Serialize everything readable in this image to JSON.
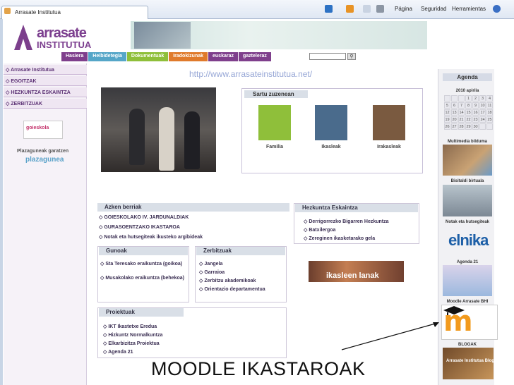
{
  "browser": {
    "tab_title": "Arrasate Institutua",
    "toolbar": {
      "page": "Página",
      "security": "Seguridad",
      "tools": "Herramientas"
    }
  },
  "header": {
    "logo_line1": "arrasate",
    "logo_line2": "INSTITUTUA"
  },
  "nav": {
    "items": [
      {
        "label": "Hasiera",
        "color": "#7f3f8c"
      },
      {
        "label": "Heibidetegia",
        "color": "#55a6c8"
      },
      {
        "label": "Dokumentuak",
        "color": "#8fbf3a"
      },
      {
        "label": "Iradokizunak",
        "color": "#e07a2b"
      },
      {
        "label": "euskaraz",
        "color": "#7f3f8c"
      },
      {
        "label": "gazteleraz",
        "color": "#7f3f8c"
      }
    ]
  },
  "url_watermark": "http://www.arrasateinstitutua.net/",
  "left_menu": {
    "items": [
      "Arrasate Institutua",
      "EGOITZAK",
      "HEZKUNTZA ESKAINTZA",
      "ZERBITZUAK"
    ],
    "goieskola": "goieskola",
    "plaza_label": "Plazaguneak garatzen",
    "plaza_logo": "plazagunea"
  },
  "sartu": {
    "title": "Sartu zuzenean",
    "tiles": [
      {
        "label": "Familia",
        "color": "#8fbf3a"
      },
      {
        "label": "Ikasleak",
        "color": "#4a6b8c"
      },
      {
        "label": "Irakasleak",
        "color": "#7a5a40"
      }
    ]
  },
  "azken_berriak": {
    "title": "Azken berriak",
    "items": [
      "GOIESKOLAKO IV. JARDUNALDIAK",
      "GURASOENTZAKO IKASTAROA",
      "Notak eta hutsegiteak ikusteko argibideak"
    ]
  },
  "hezkuntza": {
    "title": "Hezkuntza Eskaintza",
    "items": [
      "Derrigorrezko Bigarren Hezkuntza",
      "Batxilergoa",
      "Zereginen ikasketarako gela"
    ]
  },
  "gunoak": {
    "title": "Gunoak",
    "items": [
      "Sta Teresako eraikuntza (goikoa)",
      "Musakolako eraikuntza (behekoa)"
    ]
  },
  "zerbitzuak": {
    "title": "Zerbitzuak",
    "items": [
      "Jangela",
      "Garraioa",
      "Zerbitzu akademikoak",
      "Orientazio departamentua"
    ]
  },
  "ikasleen_lanak": "ikasleen lanak",
  "proiektuak": {
    "title": "Proiektuak",
    "items": [
      "IKT Ikastetxe Eredua",
      "Hizkuntz Normalkuntza",
      "Elkarbizitza Proiektua",
      "Agenda 21"
    ]
  },
  "right": {
    "agenda_title": "Agenda",
    "calendar_month": "2010 apirila",
    "calendar_days": [
      "",
      "",
      "",
      "1",
      "2",
      "3",
      "4",
      "5",
      "6",
      "7",
      "8",
      "9",
      "10",
      "11",
      "12",
      "13",
      "14",
      "15",
      "16",
      "17",
      "18",
      "19",
      "20",
      "21",
      "22",
      "23",
      "24",
      "25",
      "26",
      "27",
      "28",
      "29",
      "30",
      "",
      ""
    ],
    "multimedia": "Multimedia bilduma",
    "bisitaldi": "Bisitaldi birtuala",
    "notak": "Notak eta hutsegiteak",
    "elnika": "elnika",
    "agenda21": "Agenda 21",
    "moodle": "Moodle Arrasate BHI",
    "blogak": "BLOGAK",
    "blog_text": "Arrasate Institutua Blogak"
  },
  "caption": "MOODLE IKASTAROAK"
}
